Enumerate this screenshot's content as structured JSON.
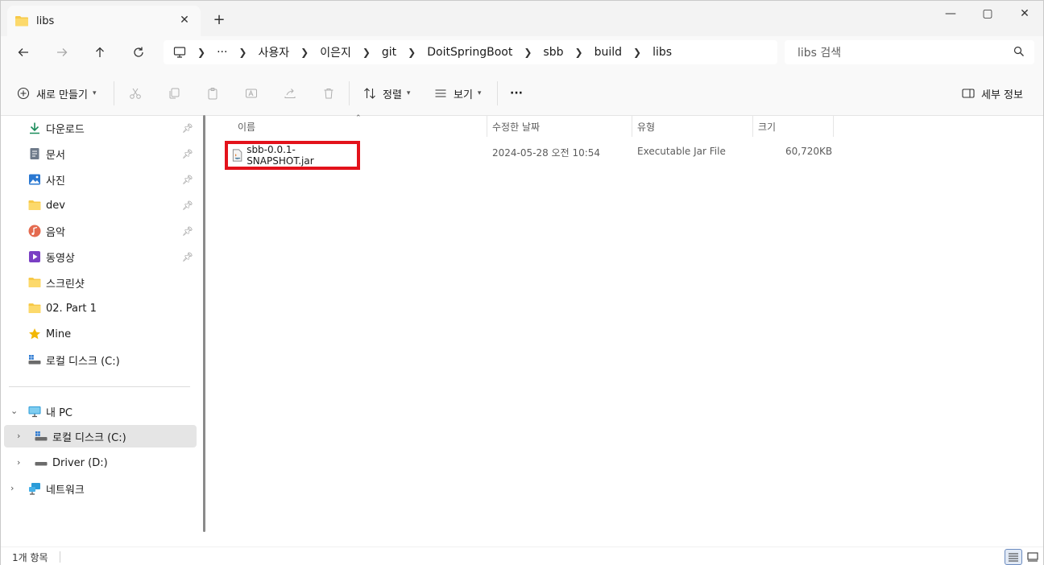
{
  "window": {
    "tab_title": "libs",
    "new_tab_label": "+",
    "controls": [
      "—",
      "▢",
      "✕"
    ]
  },
  "address": {
    "crumbs": [
      "사용자",
      "이은지",
      "git",
      "DoitSpringBoot",
      "sbb",
      "build",
      "libs"
    ],
    "overflow": "···",
    "search_placeholder": "libs 검색"
  },
  "commands": {
    "new_label": "새로 만들기",
    "sort_label": "정렬",
    "view_label": "보기",
    "more_label": "···",
    "details_label": "세부 정보"
  },
  "sidebar": {
    "quick_access": [
      {
        "label": "다운로드",
        "icon": "download-icon",
        "pinned": true
      },
      {
        "label": "문서",
        "icon": "document-icon",
        "pinned": true
      },
      {
        "label": "사진",
        "icon": "pictures-icon",
        "pinned": true
      },
      {
        "label": "dev",
        "icon": "folder-icon",
        "pinned": true
      },
      {
        "label": "음악",
        "icon": "music-icon",
        "pinned": true
      },
      {
        "label": "동영상",
        "icon": "video-icon",
        "pinned": true
      },
      {
        "label": "스크린샷",
        "icon": "folder-icon",
        "pinned": false
      },
      {
        "label": "02. Part 1",
        "icon": "folder-icon",
        "pinned": false
      },
      {
        "label": "Mine",
        "icon": "star-icon",
        "pinned": false
      },
      {
        "label": "로컬 디스크 (C:)",
        "icon": "drive-icon",
        "pinned": false
      }
    ],
    "this_pc": "내 PC",
    "drives": [
      "로컬 디스크 (C:)",
      "Driver (D:)"
    ],
    "network": "네트워크"
  },
  "columns": {
    "name": "이름",
    "modified": "수정한 날짜",
    "type": "유형",
    "size": "크기"
  },
  "files": [
    {
      "name": "sbb-0.0.1-SNAPSHOT.jar",
      "modified": "2024-05-28 오전 10:54",
      "type": "Executable Jar File",
      "size": "60,720KB"
    }
  ],
  "status": {
    "item_count": "1개 항목"
  },
  "colors": {
    "highlight": "#e3121b",
    "folder": "#f7c948",
    "selected_bg": "#e5e5e5"
  }
}
